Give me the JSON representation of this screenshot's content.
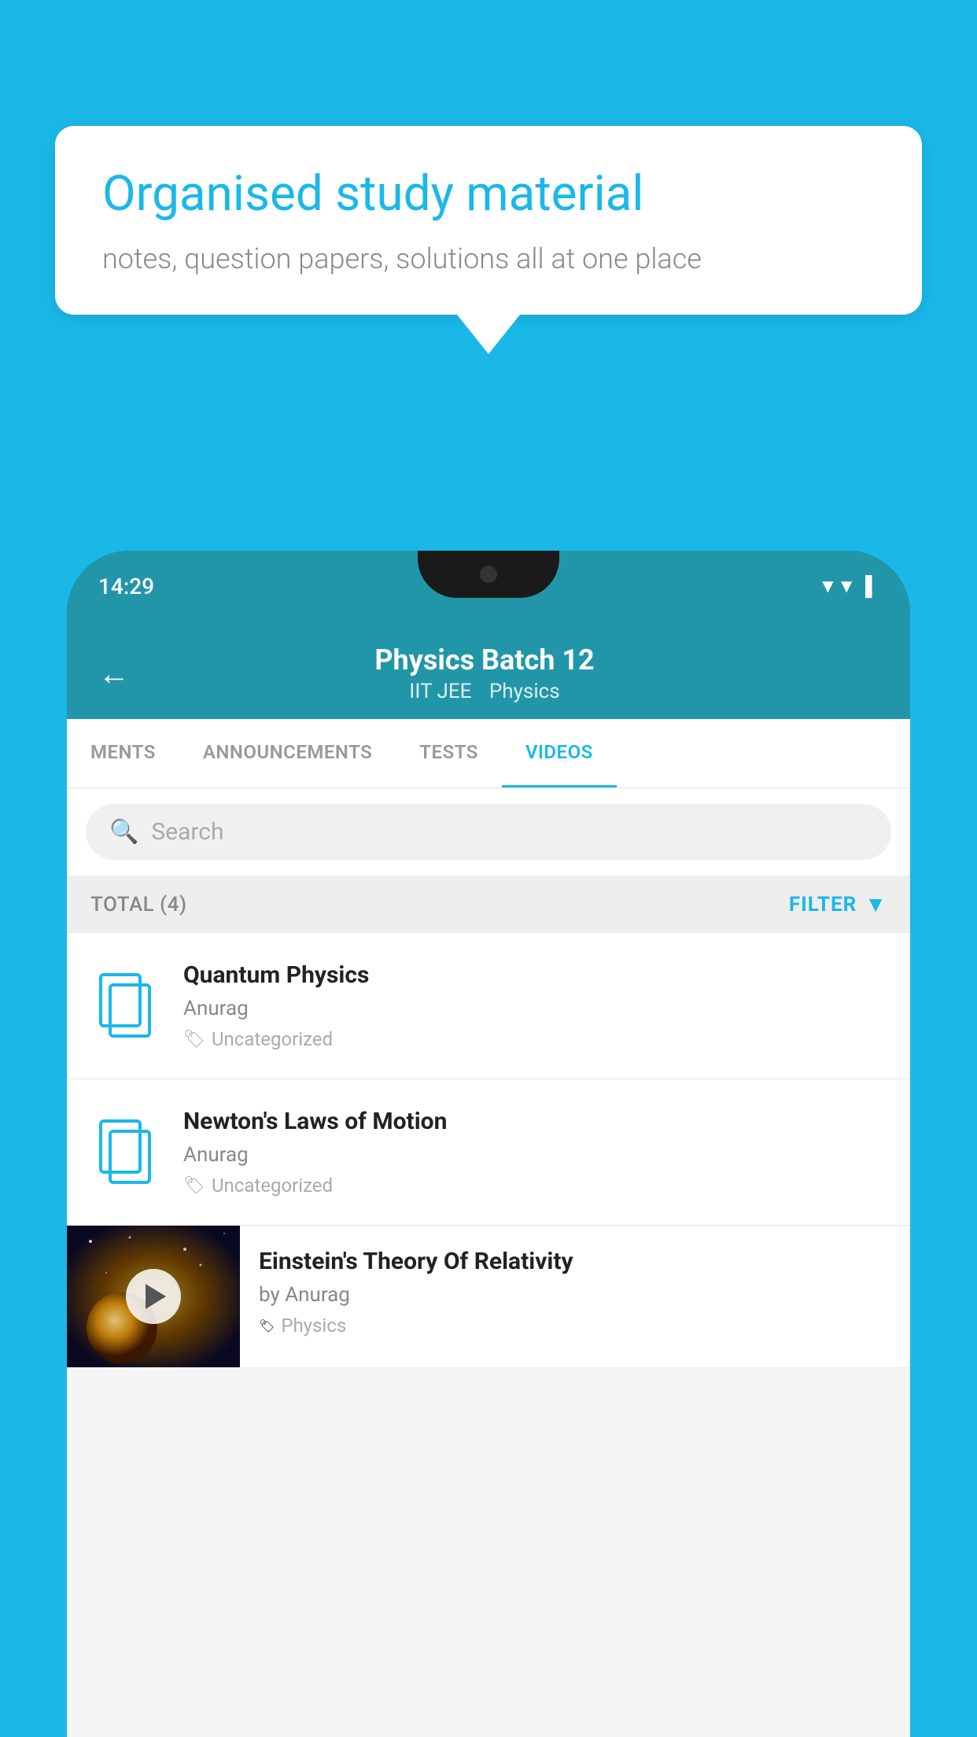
{
  "background_color": "#1ab8e8",
  "speech_bubble": {
    "title": "Organised study material",
    "subtitle": "notes, question papers, solutions all at one place"
  },
  "phone": {
    "status_bar": {
      "time": "14:29",
      "icons": [
        "wifi",
        "signal",
        "battery"
      ]
    },
    "header": {
      "back_label": "←",
      "title": "Physics Batch 12",
      "subtitle_part1": "IIT JEE",
      "subtitle_part2": "Physics"
    },
    "tabs": [
      {
        "label": "MENTS",
        "active": false
      },
      {
        "label": "ANNOUNCEMENTS",
        "active": false
      },
      {
        "label": "TESTS",
        "active": false
      },
      {
        "label": "VIDEOS",
        "active": true
      }
    ],
    "search": {
      "placeholder": "Search"
    },
    "filter": {
      "total_label": "TOTAL (4)",
      "filter_label": "FILTER"
    },
    "video_list": [
      {
        "id": 1,
        "title": "Quantum Physics",
        "author": "Anurag",
        "tag": "Uncategorized",
        "has_thumbnail": false
      },
      {
        "id": 2,
        "title": "Newton's Laws of Motion",
        "author": "Anurag",
        "tag": "Uncategorized",
        "has_thumbnail": false
      },
      {
        "id": 3,
        "title": "Einstein's Theory Of Relativity",
        "author": "by Anurag",
        "tag": "Physics",
        "has_thumbnail": true
      }
    ]
  }
}
